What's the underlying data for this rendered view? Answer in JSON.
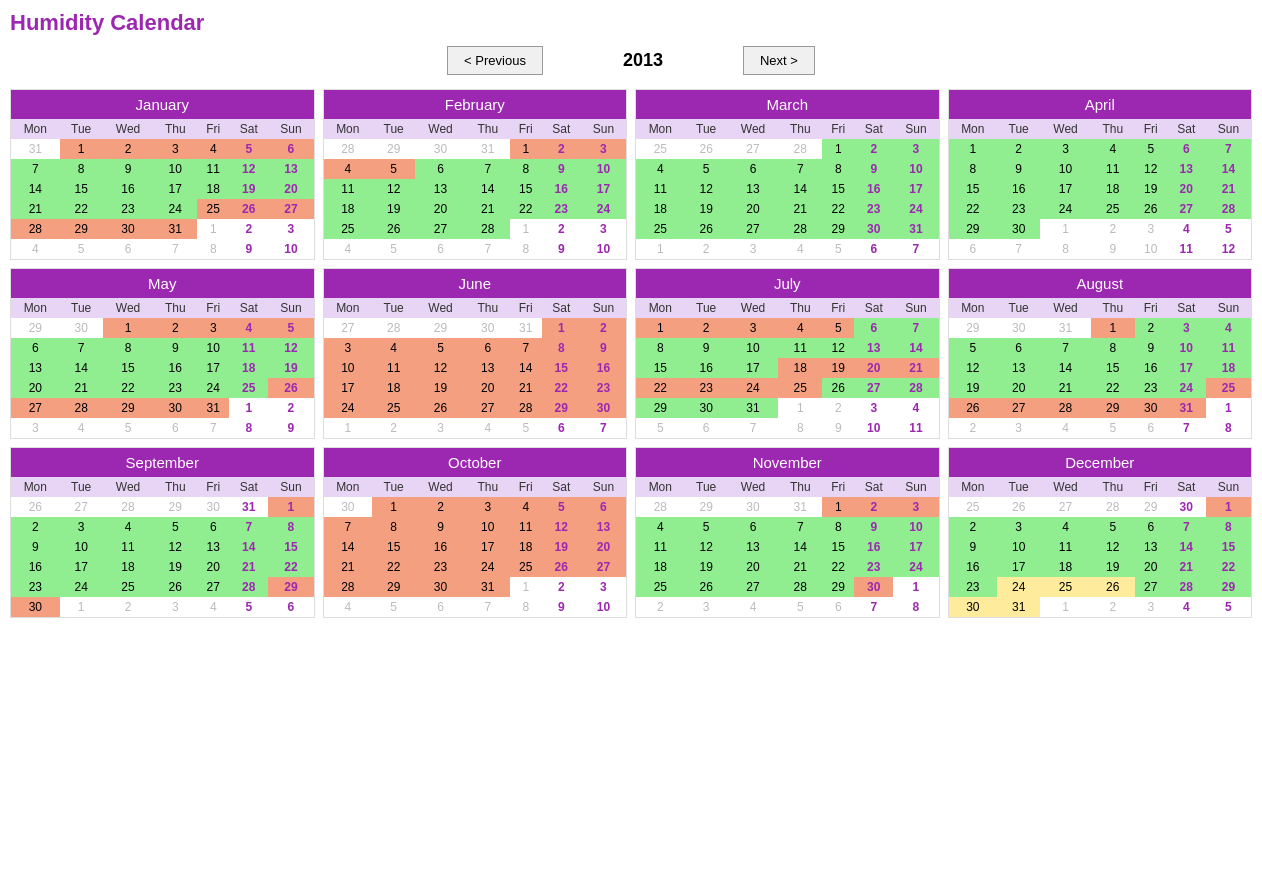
{
  "title": "Humidity Calendar",
  "year": "2013",
  "nav": {
    "prev_label": "< Previous",
    "next_label": "Next  >"
  },
  "months": [
    {
      "name": "January",
      "weekdays": [
        "Mon",
        "Tue",
        "Wed",
        "Thu",
        "Fri",
        "Sat",
        "Sun"
      ]
    },
    {
      "name": "February",
      "weekdays": [
        "Mon",
        "Tue",
        "Wed",
        "Thu",
        "Fri",
        "Sat",
        "Sun"
      ]
    },
    {
      "name": "March",
      "weekdays": [
        "Mon",
        "Tue",
        "Wed",
        "Thu",
        "Fri",
        "Sat",
        "Sun"
      ]
    },
    {
      "name": "April",
      "weekdays": [
        "Mon",
        "Tue",
        "Wed",
        "Thu",
        "Fri",
        "Sat",
        "Sun"
      ]
    },
    {
      "name": "May",
      "weekdays": [
        "Mon",
        "Tue",
        "Wed",
        "Thu",
        "Fri",
        "Sat",
        "Sun"
      ]
    },
    {
      "name": "June",
      "weekdays": [
        "Mon",
        "Tue",
        "Wed",
        "Thu",
        "Fri",
        "Sat",
        "Sun"
      ]
    },
    {
      "name": "July",
      "weekdays": [
        "Mon",
        "Tue",
        "Wed",
        "Thu",
        "Fri",
        "Sat",
        "Sun"
      ]
    },
    {
      "name": "August",
      "weekdays": [
        "Mon",
        "Tue",
        "Wed",
        "Thu",
        "Fri",
        "Sat",
        "Sun"
      ]
    },
    {
      "name": "September",
      "weekdays": [
        "Mon",
        "Tue",
        "Wed",
        "Thu",
        "Fri",
        "Sat",
        "Sun"
      ]
    },
    {
      "name": "October",
      "weekdays": [
        "Mon",
        "Tue",
        "Wed",
        "Thu",
        "Fri",
        "Sat",
        "Sun"
      ]
    },
    {
      "name": "November",
      "weekdays": [
        "Mon",
        "Tue",
        "Wed",
        "Thu",
        "Fri",
        "Sat",
        "Sun"
      ]
    },
    {
      "name": "December",
      "weekdays": [
        "Mon",
        "Tue",
        "Wed",
        "Thu",
        "Fri",
        "Sat",
        "Sun"
      ]
    }
  ]
}
